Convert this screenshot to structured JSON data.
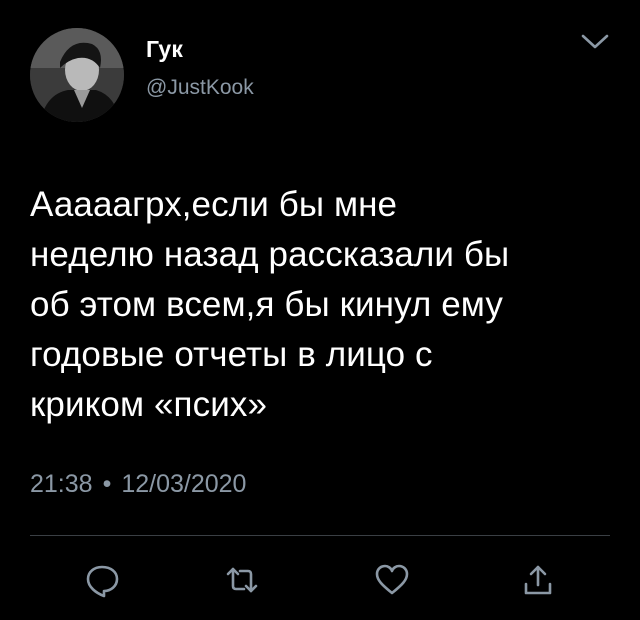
{
  "user": {
    "display_name": "Гук",
    "handle": "@JustKook",
    "avatar_icon": "profile-photo"
  },
  "tweet": {
    "text": "Ааааагрх,если бы мне\nнеделю назад рассказали бы\nоб этом всем,я бы кинул ему\nгодовые отчеты в лицо с\nкриком «псих»",
    "time": "21:38",
    "separator": "•",
    "date": "12/03/2020"
  },
  "actions": [
    {
      "icon": "reply-icon"
    },
    {
      "icon": "retweet-icon"
    },
    {
      "icon": "like-icon"
    },
    {
      "icon": "share-icon"
    }
  ],
  "colors": {
    "background": "#000000",
    "text": "#ffffff",
    "secondary": "#8b98a5",
    "divider": "#3a3f44"
  }
}
